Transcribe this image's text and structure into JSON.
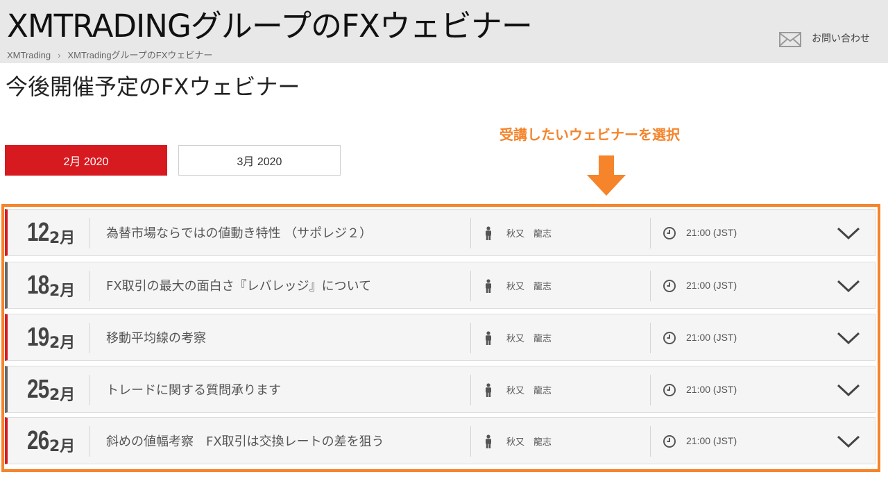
{
  "header": {
    "site_title": "XMTRADINGグループのFXウェビナー",
    "contact_label": "お問い合わせ",
    "breadcrumb": [
      "XMTrading",
      "XMTradingグループのFXウェビナー"
    ],
    "breadcrumb_separator": "›"
  },
  "page_title": "今後開催予定のFXウェビナー",
  "annotation": "受講したいウェビナーを選択",
  "month_tabs": [
    {
      "label": "2月 2020",
      "active": true
    },
    {
      "label": "3月 2020",
      "active": false
    }
  ],
  "webinars": [
    {
      "day": "12",
      "month": "2月",
      "title": "為替市場ならではの値動き特性 （サポレジ２）",
      "instructor": "秋又　龍志",
      "time": "21:00 (JST)"
    },
    {
      "day": "18",
      "month": "2月",
      "title": "FX取引の最大の面白さ『レバレッジ』について",
      "instructor": "秋又　龍志",
      "time": "21:00 (JST)"
    },
    {
      "day": "19",
      "month": "2月",
      "title": "移動平均線の考察",
      "instructor": "秋又　龍志",
      "time": "21:00 (JST)"
    },
    {
      "day": "25",
      "month": "2月",
      "title": "トレードに関する質問承ります",
      "instructor": "秋又　龍志",
      "time": "21:00 (JST)"
    },
    {
      "day": "26",
      "month": "2月",
      "title": "斜めの値幅考察　FX取引は交換レートの差を狙う",
      "instructor": "秋又　龍志",
      "time": "21:00 (JST)"
    }
  ],
  "icons": {
    "contact": "envelope-icon",
    "instructor": "person-icon",
    "time": "clock-icon",
    "expand": "chevron-down-icon",
    "pointer": "arrow-down-icon"
  },
  "colors": {
    "accent_red": "#d71920",
    "highlight_orange": "#f5842b",
    "header_bg": "#e8e8e8",
    "row_bg": "#f5f5f5"
  }
}
